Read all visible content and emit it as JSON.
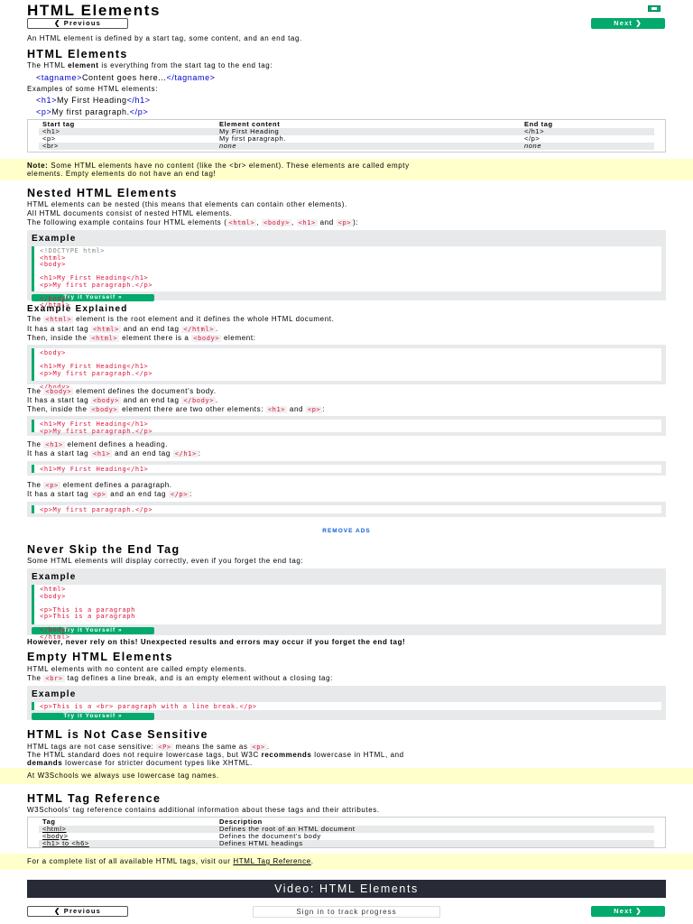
{
  "header": {
    "title": "HTML Elements",
    "prev_label": "❮ Previous",
    "next_label": "Next ❯",
    "flag_icon": "flag-icon"
  },
  "intro": "An HTML element is defined by a start tag, some content, and an end tag.",
  "elements_section": {
    "heading": "HTML Elements",
    "line_pre": "The HTML ",
    "line_bold": "element",
    "line_post": " is everything from the start tag to the end tag:",
    "syntax_open": "<tagname>",
    "syntax_content": "Content goes here...",
    "syntax_close": "</tagname>",
    "examples_label": "Examples of some HTML elements:",
    "ex1_open": "<h1>",
    "ex1_content": "My First Heading",
    "ex1_close": "</h1>",
    "ex2_open": "<p>",
    "ex2_content": "My first paragraph.",
    "ex2_close": "</p>",
    "table": {
      "headers": [
        "Start tag",
        "Element content",
        "End tag"
      ],
      "rows": [
        [
          "<h1>",
          "My First Heading",
          "</h1>"
        ],
        [
          "<p>",
          "My first paragraph.",
          "</p>"
        ],
        [
          "<br>",
          "none",
          "none"
        ]
      ]
    }
  },
  "note1": {
    "bold": "Note:",
    "text": " Some HTML elements have no content (like the <br> element). These elements are called empty",
    "text2": "elements. Empty elements do not have an end tag!"
  },
  "nested": {
    "heading": "Nested HTML Elements",
    "p1": "HTML elements can be nested (this means that elements can contain other elements).",
    "p2": "All HTML documents consist of nested HTML elements.",
    "p3_pre": "The following example contains four HTML elements (",
    "p3_c1": "<html>",
    "p3_c2": "<body>",
    "p3_c3": "<h1>",
    "p3_and": " and ",
    "p3_c4": "<p>",
    "p3_post": "):",
    "example_label": "Example",
    "code_lines": [
      "<!DOCTYPE html>",
      "<html>",
      "<body>",
      "",
      "<h1>My First Heading</h1>",
      "<p>My first paragraph.</p>",
      "",
      "</body>",
      "</html>"
    ],
    "try_label": "Try it Yourself »"
  },
  "explained": {
    "heading": "Example Explained",
    "l1_pre": "The ",
    "l1_code": "<html>",
    "l1_post": " element is the root element and it defines the whole HTML document.",
    "l2_pre": "It has a start tag ",
    "l2_code1": "<html>",
    "l2_mid": " and an end tag ",
    "l2_code2": "</html>",
    "l2_post": ".",
    "l3_pre": "Then, inside the ",
    "l3_code1": "<html>",
    "l3_mid": " element there is a ",
    "l3_code2": "<body>",
    "l3_post": " element:",
    "code1": [
      "<body>",
      "",
      "<h1>My First Heading</h1>",
      "<p>My first paragraph.</p>",
      "",
      "</body>"
    ],
    "b1_pre": "The ",
    "b1_code": "<body>",
    "b1_post": " element defines the document's body.",
    "b2_pre": "It has a start tag ",
    "b2_code1": "<body>",
    "b2_mid": " and an end tag ",
    "b2_code2": "</body>",
    "b2_post": ".",
    "b3_pre": "Then, inside the ",
    "b3_code1": "<body>",
    "b3_mid": " element there are two other elements: ",
    "b3_code2": "<h1>",
    "b3_and": " and ",
    "b3_code3": "<p>",
    "b3_post": ":",
    "code2": [
      "<h1>My First Heading</h1>",
      "<p>My first paragraph.</p>"
    ],
    "h1_pre": "The ",
    "h1_code": "<h1>",
    "h1_post": " element defines a heading.",
    "h2_pre": "It has a start tag ",
    "h2_code1": "<h1>",
    "h2_mid": " and an end tag ",
    "h2_code2": "</h1>",
    "h2_post": ":",
    "code3": [
      "<h1>My First Heading</h1>"
    ],
    "p1_pre": "The ",
    "p1_code": "<p>",
    "p1_post": " element defines a paragraph.",
    "p2_pre": "It has a start tag ",
    "p2_code1": "<p>",
    "p2_mid": " and an end tag ",
    "p2_code2": "</p>",
    "p2_post": ":",
    "code4": [
      "<p>My first paragraph.</p>"
    ]
  },
  "remove_ads": "REMOVE ADS",
  "never_skip": {
    "heading": "Never Skip the End Tag",
    "p1": "Some HTML elements will display correctly, even if you forget the end tag:",
    "example_label": "Example",
    "code": [
      "<html>",
      "<body>",
      "",
      "<p>This is a paragraph",
      "<p>This is a paragraph",
      "",
      "</body>",
      "</html>"
    ],
    "try_label": "Try it Yourself »",
    "warning": "However, never rely on this! Unexpected results and errors may occur if you forget the end tag!"
  },
  "empty": {
    "heading": "Empty HTML Elements",
    "p1": "HTML elements with no content are called empty elements.",
    "p2_pre": "The ",
    "p2_code": "<br>",
    "p2_post": " tag defines a line break, and is an empty element without a closing tag:",
    "example_label": "Example",
    "code": [
      "<p>This is a <br> paragraph with a line break.</p>"
    ],
    "try_label": "Try it Yourself »"
  },
  "case": {
    "heading": "HTML is Not Case Sensitive",
    "p1_pre": "HTML tags are not case sensitive: ",
    "p1_code1": "<P>",
    "p1_mid": " means the same as ",
    "p1_code2": "<p>",
    "p1_post": ".",
    "p2_pre": "The HTML standard does not require lowercase tags, but W3C ",
    "p2_bold": "recommends",
    "p2_post": " lowercase in HTML, and",
    "p3_bold": "demands",
    "p3_post": " lowercase for stricter document types like XHTML.",
    "note": "At W3Schools we always use lowercase tag names."
  },
  "tagref": {
    "heading": "HTML Tag Reference",
    "p1": "W3Schools' tag reference contains additional information about these tags and their attributes.",
    "headers": [
      "Tag",
      "Description"
    ],
    "rows": [
      [
        "<html>",
        "Defines the root of an HTML document"
      ],
      [
        "<body>",
        "Defines the document's body"
      ],
      [
        "<h1> to <h6>",
        "Defines HTML headings"
      ]
    ],
    "note_pre": "For a complete list of all available HTML tags, visit our ",
    "note_link": "HTML Tag Reference",
    "note_post": "."
  },
  "video": "Video: HTML Elements",
  "footer": {
    "prev_label": "❮ Previous",
    "sign_in": "Sign in to track progress",
    "next_label": "Next ❯"
  },
  "colors": {
    "accent": "#04aa6d",
    "tag": "#a52a2a",
    "code_red": "#dc143c",
    "note_bg": "#ffffcc",
    "banner": "#282a35"
  }
}
